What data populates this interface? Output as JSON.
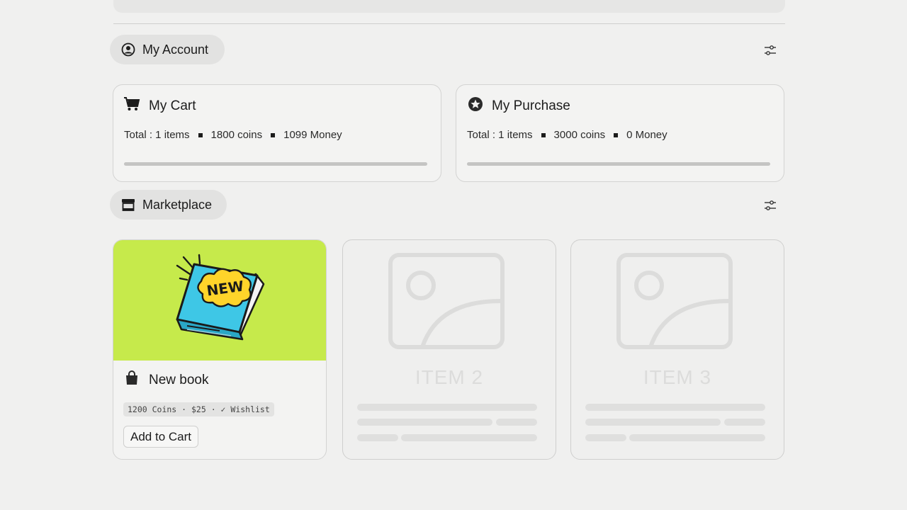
{
  "account": {
    "title": "My Account",
    "icon": "user-circle-icon"
  },
  "cart": {
    "title": "My Cart",
    "icon": "cart-icon",
    "total": "Total : 1 items",
    "coins": "1800 coins",
    "money": "1099 Money"
  },
  "purchase": {
    "title": "My Purchase",
    "icon": "star-badge-icon",
    "total": "Total : 1 items",
    "coins": "3000 coins",
    "money": "0 Money"
  },
  "marketplace": {
    "title": "Marketplace",
    "icon": "store-icon",
    "items": [
      {
        "name": "New book",
        "badge_text": "NEW",
        "meta": "1200 Coins · $25 · ✓ Wishlist",
        "action": "Add to Cart",
        "image_bg": "#c6ea4b",
        "icon": "shopping-bag-icon"
      },
      {
        "label": "ITEM 2"
      },
      {
        "label": "ITEM 3"
      }
    ]
  },
  "colors": {
    "page_bg": "#f0f0ef",
    "accent_green": "#c6ea4b",
    "book_blue": "#3ec7e6",
    "badge_yellow": "#ffd42a"
  }
}
